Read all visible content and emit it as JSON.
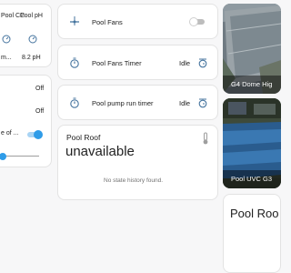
{
  "colors": {
    "accent": "#2f9ce8",
    "icon": "#44739e",
    "grey": "#727272"
  },
  "sensors": {
    "cc_label": "Pool CC",
    "ph_label": "Pool pH",
    "cc_value": "m...",
    "ph_value": "8.2 pH"
  },
  "switches": {
    "row1_state": "Off",
    "row2_state": "Off",
    "row3_label": "e of ...",
    "row3_toggle": "on",
    "slider_level": 0
  },
  "pool_fans": {
    "name": "Pool Fans",
    "icon": "ceiling-fan-icon",
    "toggle": "off"
  },
  "fans_timer": {
    "name": "Pool Fans Timer",
    "state": "Idle",
    "icon": "timer-icon",
    "action_icon": "timer-cancel-icon"
  },
  "pump_timer": {
    "name": "Pool pump run timer",
    "state": "Idle",
    "icon": "timer-icon",
    "action_icon": "timer-cancel-icon"
  },
  "pool_roof": {
    "title": "Pool Roof",
    "value": "unavailable",
    "history": "No state history found.",
    "icon": "thermometer-icon"
  },
  "cameras": [
    {
      "caption": "G4 Dome Hig"
    },
    {
      "caption": "Pool UVC G3"
    }
  ],
  "roof_card": {
    "title": "Pool Roo"
  }
}
